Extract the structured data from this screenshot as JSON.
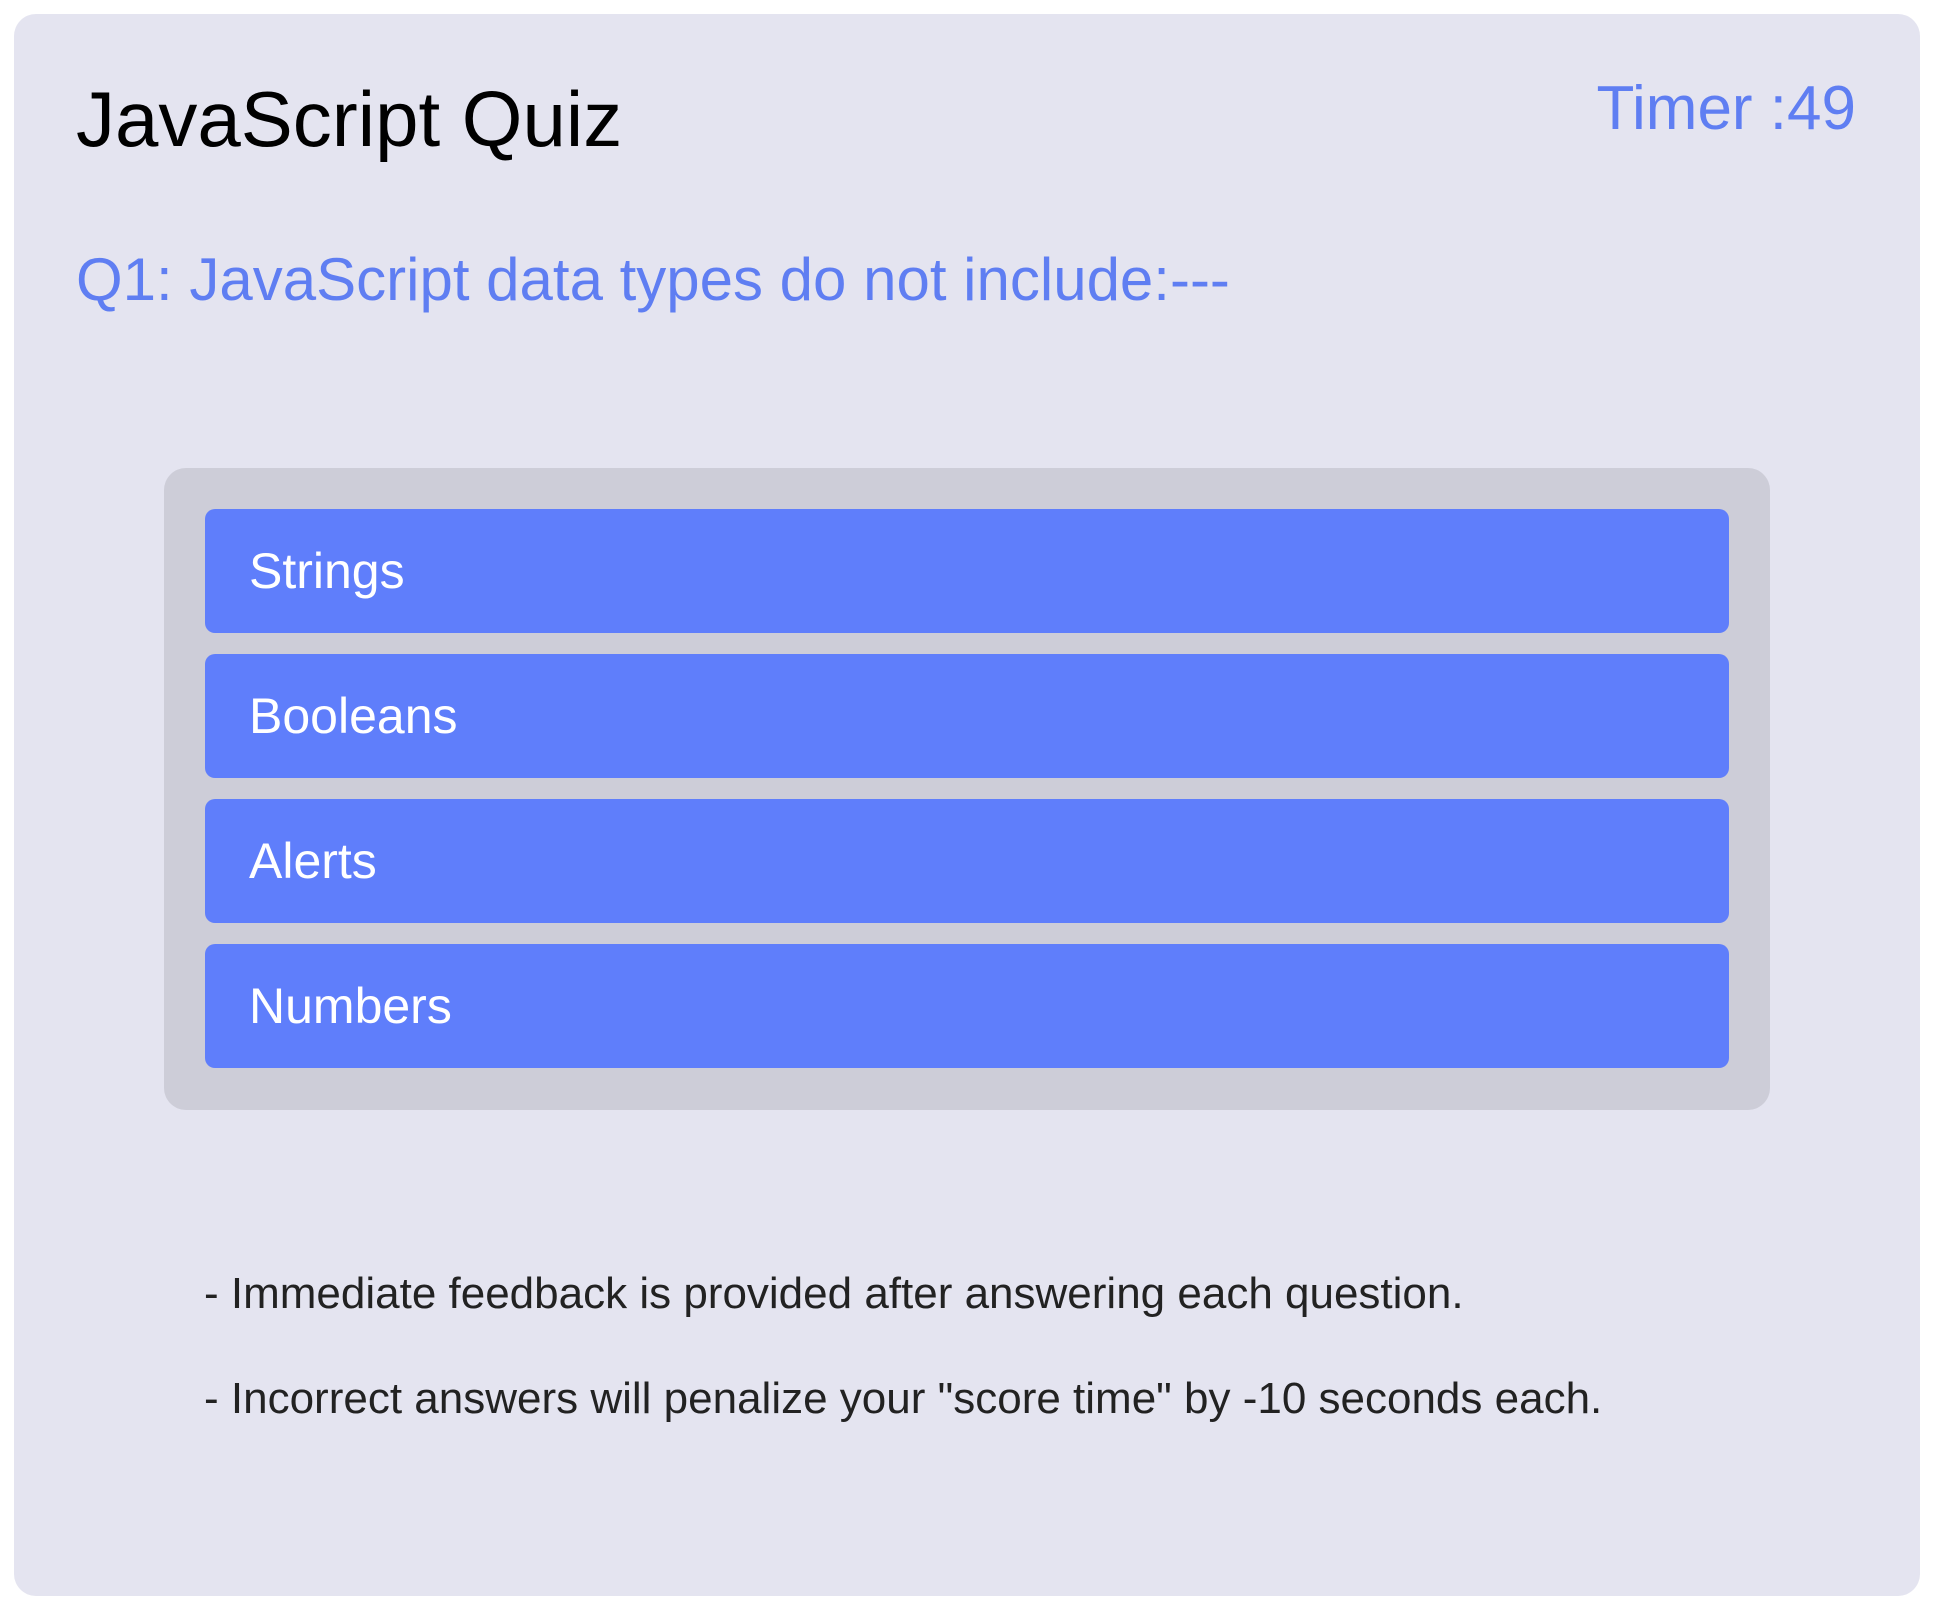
{
  "quiz": {
    "title": "JavaScript Quiz",
    "timer_label": "Timer :49",
    "question": "Q1: JavaScript data types do not include:---",
    "choices": [
      {
        "label": "Strings"
      },
      {
        "label": "Booleans"
      },
      {
        "label": "Alerts"
      },
      {
        "label": "Numbers"
      }
    ],
    "rules": [
      "- Immediate feedback is provided after answering each question.",
      "- Incorrect answers will penalize your \"score time\" by -10 seconds each."
    ]
  },
  "colors": {
    "card_background": "#e4e4f0",
    "accent": "#5f7ef2",
    "choice_button": "#5f7efb",
    "choices_panel": "#cdcdd8"
  }
}
